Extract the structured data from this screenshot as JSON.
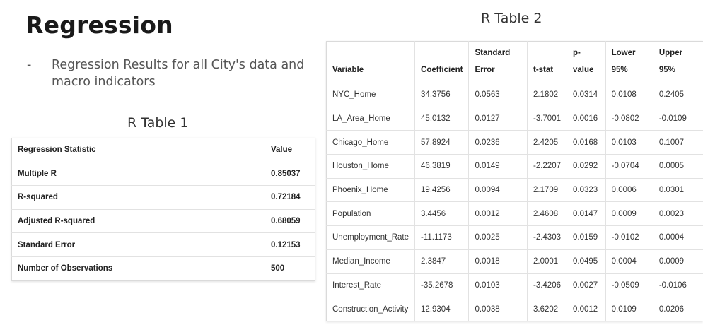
{
  "title": "Regression",
  "bullet": {
    "marker": "-",
    "text": "Regression Results for all City's  data and macro indicators"
  },
  "table1": {
    "caption": "R Table 1",
    "headers": [
      "Regression Statistic",
      "Value"
    ],
    "rows": [
      [
        "Multiple R",
        "0.85037"
      ],
      [
        "R-squared",
        "0.72184"
      ],
      [
        "Adjusted R-squared",
        "0.68059"
      ],
      [
        "Standard Error",
        "0.12153"
      ],
      [
        "Number of Observations",
        "500"
      ]
    ]
  },
  "table2": {
    "caption": "R Table 2",
    "headers": [
      "Variable",
      "Coefficient",
      "Standard Error",
      "t-stat",
      "p-value",
      "Lower 95%",
      "Upper 95%"
    ],
    "rows": [
      [
        "NYC_Home",
        "34.3756",
        "0.0563",
        "2.1802",
        "0.0314",
        "0.0108",
        "0.2405"
      ],
      [
        "LA_Area_Home",
        "45.0132",
        "0.0127",
        "-3.7001",
        "0.0016",
        "-0.0802",
        "-0.0109"
      ],
      [
        "Chicago_Home",
        "57.8924",
        "0.0236",
        "2.4205",
        "0.0168",
        "0.0103",
        "0.1007"
      ],
      [
        "Houston_Home",
        "46.3819",
        "0.0149",
        "-2.2207",
        "0.0292",
        "-0.0704",
        "0.0005"
      ],
      [
        "Phoenix_Home",
        "19.4256",
        "0.0094",
        "2.1709",
        "0.0323",
        "0.0006",
        "0.0301"
      ],
      [
        "Population",
        "3.4456",
        "0.0012",
        "2.4608",
        "0.0147",
        "0.0009",
        "0.0023"
      ],
      [
        "Unemployment_Rate",
        "-11.1173",
        "0.0025",
        "-2.4303",
        "0.0159",
        "-0.0102",
        "0.0004"
      ],
      [
        "Median_Income",
        "2.3847",
        "0.0018",
        "2.0001",
        "0.0495",
        "0.0004",
        "0.0009"
      ],
      [
        "Interest_Rate",
        "-35.2678",
        "0.0103",
        "-3.4206",
        "0.0027",
        "-0.0509",
        "-0.0106"
      ],
      [
        "Construction_Activity",
        "12.9304",
        "0.0038",
        "3.6202",
        "0.0012",
        "0.0109",
        "0.0206"
      ]
    ]
  }
}
